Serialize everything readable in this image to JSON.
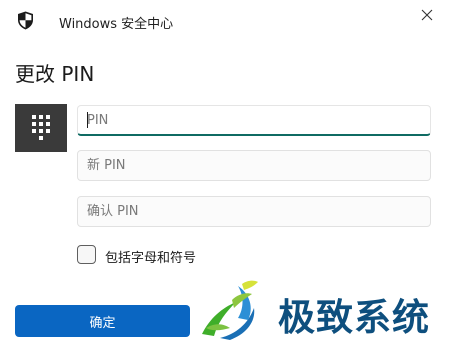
{
  "window": {
    "app_title": "Windows 安全中心",
    "close_glyph": "✕"
  },
  "dialog": {
    "heading": "更改 PIN"
  },
  "fields": {
    "pin": {
      "placeholder": "PIN",
      "value": ""
    },
    "new_pin": {
      "placeholder": "新 PIN",
      "value": ""
    },
    "confirm_pin": {
      "placeholder": "确认 PIN",
      "value": ""
    }
  },
  "options": {
    "include_letters_label": "包括字母和符号",
    "include_letters_checked": false
  },
  "buttons": {
    "ok_label": "确定"
  },
  "watermark": {
    "text": "极致系统"
  },
  "icons": {
    "shield": "shield-icon",
    "keypad": "keypad-icon",
    "close": "close-icon"
  },
  "colors": {
    "accent": "#0a66c2",
    "focus_underline": "#0f6b63",
    "keypad_tile": "#3a3a3a",
    "watermark_text": "#0e4f7e"
  }
}
